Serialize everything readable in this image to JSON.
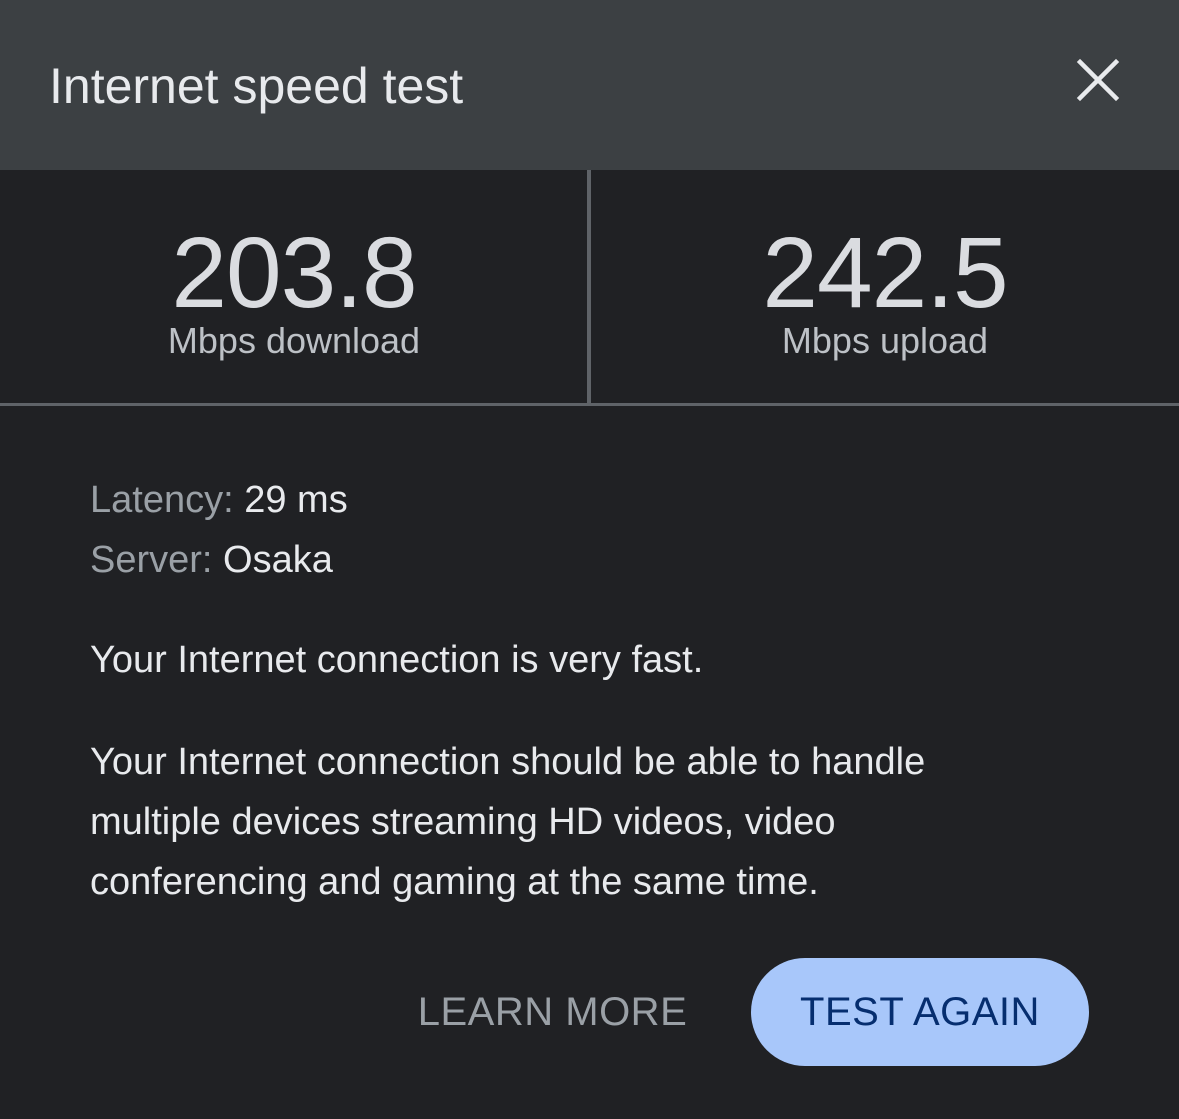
{
  "header": {
    "title": "Internet speed test",
    "close_icon": "close-icon"
  },
  "stats": {
    "download": {
      "value": "203.8",
      "label": "Mbps download"
    },
    "upload": {
      "value": "242.5",
      "label": "Mbps upload"
    }
  },
  "details": {
    "latency_key": "Latency:",
    "latency_value": "29 ms",
    "server_key": "Server:",
    "server_value": "Osaka"
  },
  "verdict": "Your Internet connection is very fast.",
  "description": "Your Internet connection should be able to handle multiple devices streaming HD videos, video conferencing and gaming at the same time.",
  "actions": {
    "learn_more": "LEARN MORE",
    "test_again": "TEST AGAIN"
  },
  "colors": {
    "header_bg": "#3c4043",
    "body_bg": "#202124",
    "accent_button": "#a8c7fa"
  }
}
